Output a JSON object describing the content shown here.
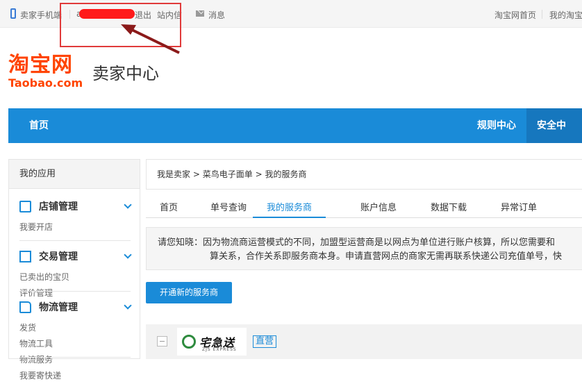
{
  "topbar": {
    "seller_mobile": "卖家手机端",
    "logout": "退出",
    "site_msg": "站内信",
    "messages": "消息",
    "taobao_home": "淘宝网首页",
    "my_taobao": "我的淘宝"
  },
  "logo": {
    "cn": "淘宝网",
    "en": "Taobao.com"
  },
  "header": {
    "title": "卖家中心"
  },
  "nav": {
    "home": "首页",
    "rules": "规则中心",
    "security": "安全中心"
  },
  "sidebar": {
    "title": "我的应用",
    "groups": [
      {
        "title": "店铺管理",
        "icon": "store-icon",
        "links": [
          "我要开店"
        ]
      },
      {
        "title": "交易管理",
        "icon": "document-icon",
        "links": [
          "已卖出的宝贝",
          "评价管理"
        ]
      },
      {
        "title": "物流管理",
        "icon": "truck-icon",
        "links": [
          "发货",
          "物流工具",
          "物流服务",
          "我要寄快递"
        ]
      }
    ]
  },
  "breadcrumb": {
    "level1": "我是卖家",
    "level2": "菜鸟电子面单",
    "level3": "我的服务商",
    "separator": ">"
  },
  "tabs": [
    {
      "label": "首页"
    },
    {
      "label": "单号查询"
    },
    {
      "label": "我的服务商",
      "active": true
    },
    {
      "label": "账户信息"
    },
    {
      "label": "数据下载"
    },
    {
      "label": "异常订单"
    }
  ],
  "notice": {
    "line1": "请您知晓：因为物流商运营模式的不同，加盟型运营商是以网点为单位进行账户核算，所以您需要和",
    "line2": "算关系，合作关系即服务商本身。申请直营网点的商家无需再联系快递公司充值单号，快"
  },
  "actions": {
    "open_provider": "开通新的服务商"
  },
  "provider": {
    "logo_text": "宅急送",
    "logo_sub": "ZJS EXPRESS",
    "tag": "直营"
  },
  "colors": {
    "brand_blue": "#1a8bd8",
    "taobao_orange": "#ff4400",
    "annotation_red": "#e03a3a"
  }
}
